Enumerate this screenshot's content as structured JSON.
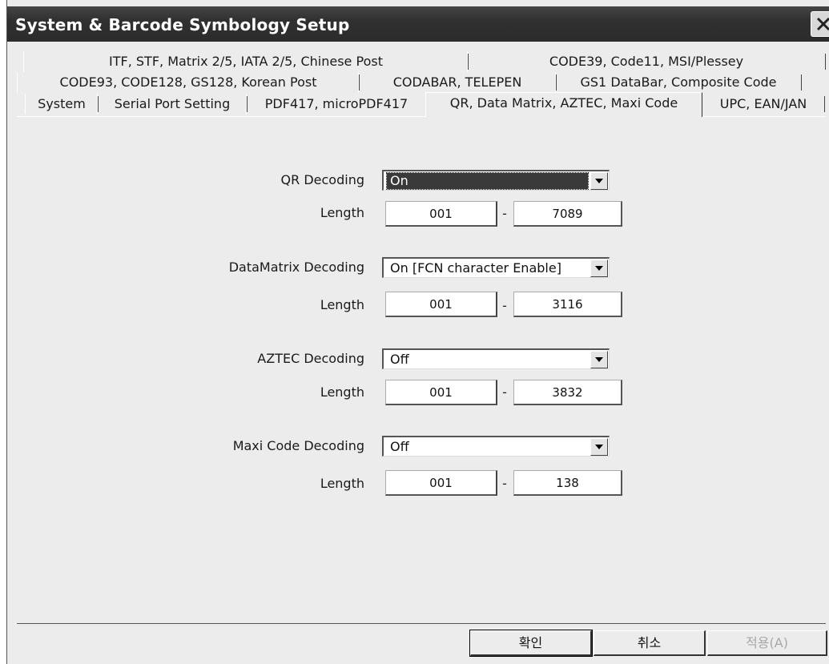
{
  "window": {
    "title": "System & Barcode Symbology Setup"
  },
  "tabs": {
    "row1": [
      "ITF, STF, Matrix 2/5, IATA 2/5, Chinese Post",
      "CODE39, Code11, MSI/Plessey"
    ],
    "row2": [
      "CODE93, CODE128, GS128, Korean Post",
      "CODABAR, TELEPEN",
      "GS1 DataBar, Composite Code"
    ],
    "row3": [
      "System",
      "Serial Port Setting",
      "PDF417, microPDF417",
      "QR, Data Matrix, AZTEC, Maxi Code",
      "UPC, EAN/JAN"
    ],
    "active": "QR, Data Matrix, AZTEC, Maxi Code"
  },
  "settings": {
    "qr": {
      "label": "QR Decoding",
      "value": "On",
      "length_label": "Length",
      "min": "001",
      "max": "7089"
    },
    "datamatrix": {
      "label": "DataMatrix Decoding",
      "value": "On [FCN character Enable]",
      "length_label": "Length",
      "min": "001",
      "max": "3116"
    },
    "aztec": {
      "label": "AZTEC Decoding",
      "value": "Off",
      "length_label": "Length",
      "min": "001",
      "max": "3832"
    },
    "maxicode": {
      "label": "Maxi Code Decoding",
      "value": "Off",
      "length_label": "Length",
      "min": "001",
      "max": "138"
    },
    "range_separator": "-"
  },
  "buttons": {
    "ok": "확인",
    "cancel": "취소",
    "apply": "적용(A)"
  },
  "icons": {
    "close": "close-icon",
    "dropdown": "chevron-down-icon"
  }
}
